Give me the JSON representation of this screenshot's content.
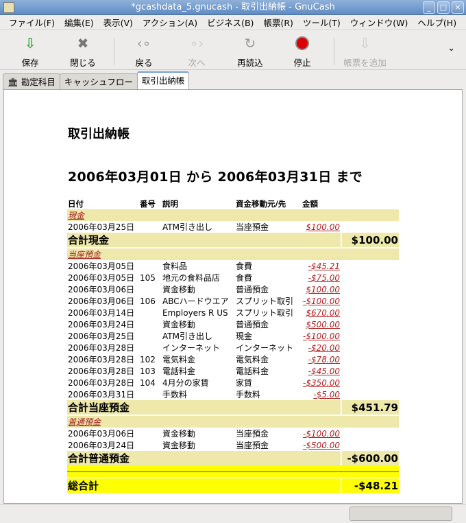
{
  "window": {
    "title": "*gcashdata_5.gnucash - 取引出納帳 - GnuCash"
  },
  "menu": [
    "ファイル(F)",
    "編集(E)",
    "表示(V)",
    "アクション(A)",
    "ビジネス(B)",
    "帳票(R)",
    "ツール(T)",
    "ウィンドウ(W)",
    "ヘルプ(H)"
  ],
  "toolbar": {
    "save": "保存",
    "close": "閉じる",
    "back": "戻る",
    "forward": "次へ",
    "reload": "再読込",
    "stop": "停止",
    "add_report": "帳票を追加"
  },
  "tabs": [
    "勘定科目",
    "キャッシュフロー",
    "取引出納帳"
  ],
  "report": {
    "title": "取引出納帳",
    "subtitle": "2006年03月01日 から 2006年03月31日 まで",
    "headers": [
      "日付",
      "番号",
      "説明",
      "資金移動元/先",
      "金額"
    ],
    "accounts": [
      {
        "name": "現金",
        "rows": [
          [
            "2006年03月25日",
            "",
            "ATM引き出し",
            "当座預金",
            "$100.00"
          ]
        ],
        "total_label": "合計現金",
        "total": "$100.00"
      },
      {
        "name": "当座預金",
        "rows": [
          [
            "2006年03月05日",
            "",
            "食料品",
            "食費",
            "-$45.21"
          ],
          [
            "2006年03月05日",
            "105",
            "地元の食料品店",
            "食費",
            "-$75.00"
          ],
          [
            "2006年03月06日",
            "",
            "資金移動",
            "普通預金",
            "$100.00"
          ],
          [
            "2006年03月06日",
            "106",
            "ABCハードウエア",
            "スプリット取引",
            "-$100.00"
          ],
          [
            "2006年03月14日",
            "",
            "Employers R US",
            "スプリット取引",
            "$670.00"
          ],
          [
            "2006年03月24日",
            "",
            "資金移動",
            "普通預金",
            "$500.00"
          ],
          [
            "2006年03月25日",
            "",
            "ATM引き出し",
            "現金",
            "-$100.00"
          ],
          [
            "2006年03月28日",
            "",
            "インターネット",
            "インターネット",
            "-$20.00"
          ],
          [
            "2006年03月28日",
            "102",
            "電気料金",
            "電気料金",
            "-$78.00"
          ],
          [
            "2006年03月28日",
            "103",
            "電話料金",
            "電話料金",
            "-$45.00"
          ],
          [
            "2006年03月28日",
            "104",
            "4月分の家賃",
            "家賃",
            "-$350.00"
          ],
          [
            "2006年03月31日",
            "",
            "手数料",
            "手数料",
            "-$5.00"
          ]
        ],
        "total_label": "合計当座預金",
        "total": "$451.79"
      },
      {
        "name": "普通預金",
        "rows": [
          [
            "2006年03月06日",
            "",
            "資金移動",
            "当座預金",
            "-$100.00"
          ],
          [
            "2006年03月24日",
            "",
            "資金移動",
            "当座預金",
            "-$500.00"
          ]
        ],
        "total_label": "合計普通預金",
        "total": "-$600.00"
      }
    ],
    "grand_total_label": "総合計",
    "grand_total": "-$48.21"
  },
  "colors": {
    "account_row": "#eee8aa",
    "grand_total_row": "#ffff00",
    "link": "#a02020"
  }
}
